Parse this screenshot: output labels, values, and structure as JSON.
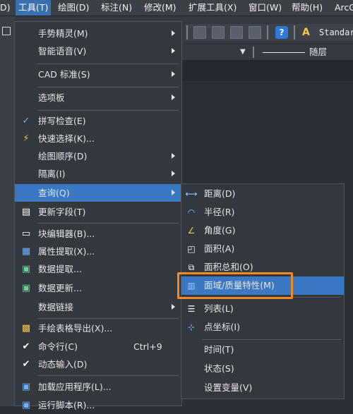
{
  "menubar": {
    "items": [
      {
        "label": "D)"
      },
      {
        "label": "工具(T)"
      },
      {
        "label": "绘图(D)"
      },
      {
        "label": "标注(N)"
      },
      {
        "label": "修改(M)"
      },
      {
        "label": "扩展工具(X)"
      },
      {
        "label": "窗口(W)"
      },
      {
        "label": "帮助(H)"
      },
      {
        "label": "ArcG"
      }
    ]
  },
  "toolbar": {
    "style_value": "Standar",
    "layer_label": "随层"
  },
  "tools_menu": {
    "items": [
      {
        "label": "手势精灵(M)",
        "icon": "",
        "has_submenu": true
      },
      {
        "label": "智能语音(V)",
        "icon": "",
        "has_submenu": true
      },
      {
        "label": "CAD 标准(S)",
        "icon": "",
        "has_submenu": true
      },
      {
        "label": "选项板",
        "icon": "",
        "has_submenu": true
      },
      {
        "label": "拼写检查(E)",
        "icon": "spell-check-icon"
      },
      {
        "label": "快速选择(K)...",
        "icon": "quick-select-icon"
      },
      {
        "label": "绘图顺序(D)",
        "icon": "",
        "has_submenu": true
      },
      {
        "label": "隔离(I)",
        "icon": "",
        "has_submenu": true
      },
      {
        "label": "查询(Q)",
        "icon": "",
        "has_submenu": true,
        "highlighted": true
      },
      {
        "label": "更新字段(T)",
        "icon": "update-field-icon"
      },
      {
        "label": "块编辑器(B)...",
        "icon": "block-editor-icon"
      },
      {
        "label": "属性提取(X)...",
        "icon": "attribute-extract-icon"
      },
      {
        "label": "数据提取...",
        "icon": "data-extract-icon"
      },
      {
        "label": "数据更新...",
        "icon": "data-update-icon"
      },
      {
        "label": "数据链接",
        "icon": "",
        "has_submenu": true
      },
      {
        "label": "手绘表格导出(X)...",
        "icon": "table-export-icon"
      },
      {
        "label": "命令行(C)",
        "icon": "checkmark-icon",
        "shortcut": "Ctrl+9"
      },
      {
        "label": "动态输入(D)",
        "icon": "checkmark-icon"
      },
      {
        "label": "加载应用程序(L)...",
        "icon": "load-app-icon"
      },
      {
        "label": "运行脚本(R)...",
        "icon": "run-script-icon"
      }
    ]
  },
  "query_submenu": {
    "items": [
      {
        "label": "距离(D)",
        "icon": "distance-icon"
      },
      {
        "label": "半径(R)",
        "icon": "radius-icon"
      },
      {
        "label": "角度(G)",
        "icon": "angle-icon"
      },
      {
        "label": "面积(A)",
        "icon": "area-icon"
      },
      {
        "label": "面积总和(O)",
        "icon": "area-total-icon"
      },
      {
        "label": "面域/质量特性(M)",
        "icon": "mass-properties-icon",
        "highlighted": true
      },
      {
        "label": "列表(L)",
        "icon": "list-icon"
      },
      {
        "label": "点坐标(I)",
        "icon": "point-coordinate-icon"
      },
      {
        "label": "时间(T)",
        "icon": ""
      },
      {
        "label": "状态(S)",
        "icon": ""
      },
      {
        "label": "设置变量(V)",
        "icon": ""
      }
    ]
  },
  "colors": {
    "highlight": "#3b78c3",
    "annotation_box": "#f08a24"
  }
}
